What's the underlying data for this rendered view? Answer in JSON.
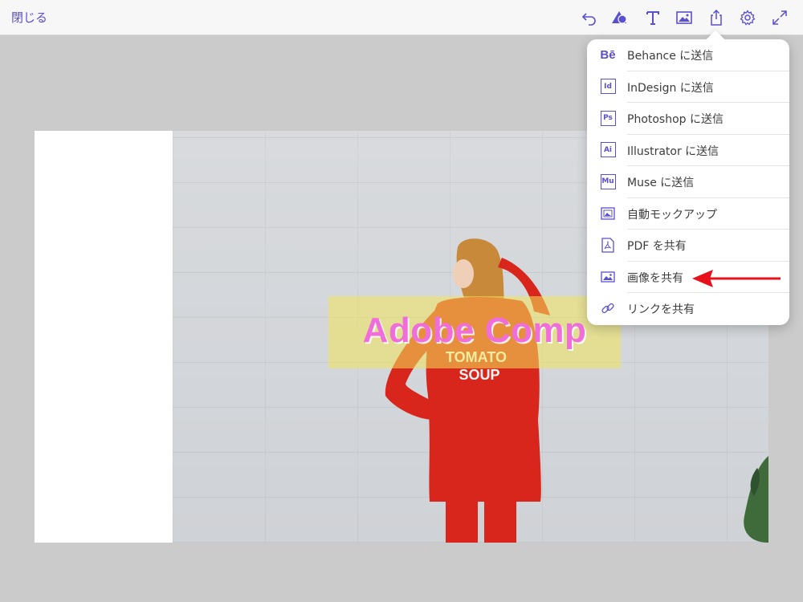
{
  "topbar": {
    "close_label": "閉じる",
    "tools": [
      "undo-icon",
      "shapes-icon",
      "text-icon",
      "image-icon",
      "share-icon",
      "settings-icon",
      "fullscreen-icon"
    ]
  },
  "canvas": {
    "banner_text": "Adobe Comp"
  },
  "share_menu": {
    "items": [
      {
        "icon": "Bē",
        "label": "Behance に送信"
      },
      {
        "icon": "Id",
        "label": "InDesign に送信"
      },
      {
        "icon": "Ps",
        "label": "Photoshop に送信"
      },
      {
        "icon": "Ai",
        "label": "Illustrator に送信"
      },
      {
        "icon": "Mu",
        "label": "Muse に送信"
      },
      {
        "icon": "mockup-icon",
        "label": "自動モックアップ"
      },
      {
        "icon": "pdf-icon",
        "label": "PDF を共有"
      },
      {
        "icon": "image-icon",
        "label": "画像を共有"
      },
      {
        "icon": "link-icon",
        "label": "リンクを共有"
      }
    ]
  },
  "colors": {
    "accent": "#5a4fcf",
    "annotation_arrow": "#e8101a",
    "banner_text": "#f06ed9",
    "banner_fill": "#f0e65a"
  }
}
